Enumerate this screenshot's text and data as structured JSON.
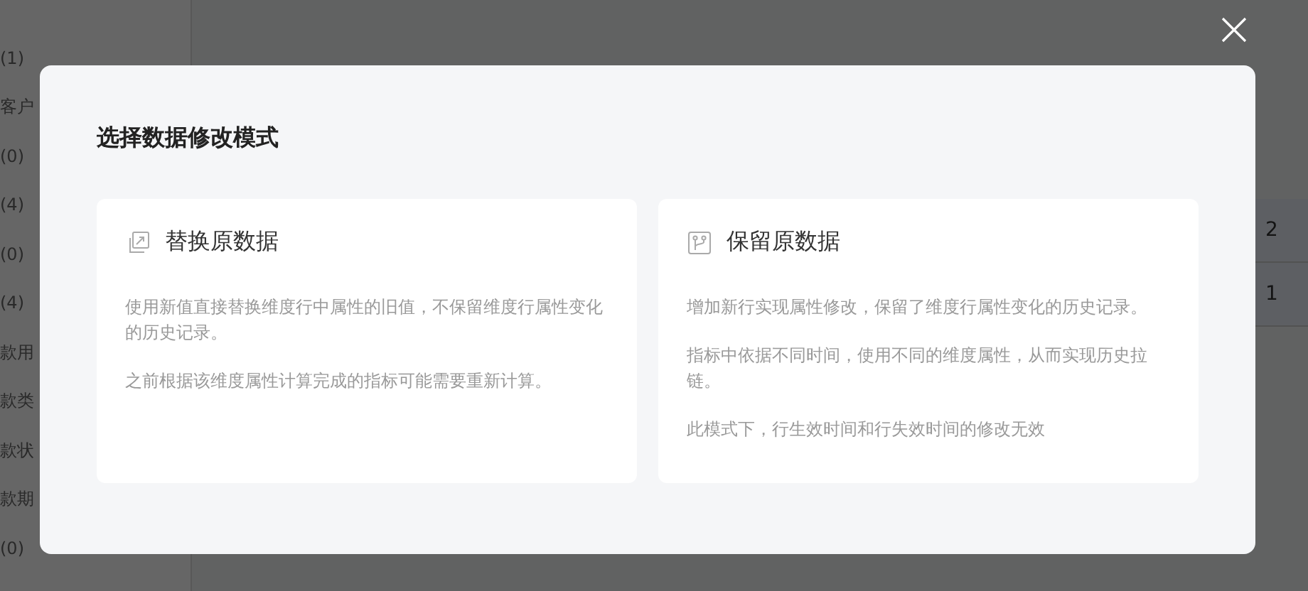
{
  "background": {
    "sidebar_items": [
      "(1)",
      "客户",
      "(0)",
      "(4)",
      "(0)",
      "(4)",
      "款用",
      "款类",
      "款状",
      "款期",
      "(0)"
    ],
    "row_fragments": [
      "2",
      "1"
    ]
  },
  "dialog": {
    "title": "选择数据修改模式",
    "options": [
      {
        "kind": "replace",
        "title": "替换原数据",
        "paragraphs": [
          "使用新值直接替换维度行中属性的旧值，不保留维度行属性变化的历史记录。",
          "之前根据该维度属性计算完成的指标可能需要重新计算。"
        ]
      },
      {
        "kind": "keep",
        "title": "保留原数据",
        "paragraphs": [
          "增加新行实现属性修改，保留了维度行属性变化的历史记录。",
          "指标中依据不同时间，使用不同的维度属性，从而实现历史拉链。",
          "此模式下，行生效时间和行失效时间的修改无效"
        ]
      }
    ]
  }
}
